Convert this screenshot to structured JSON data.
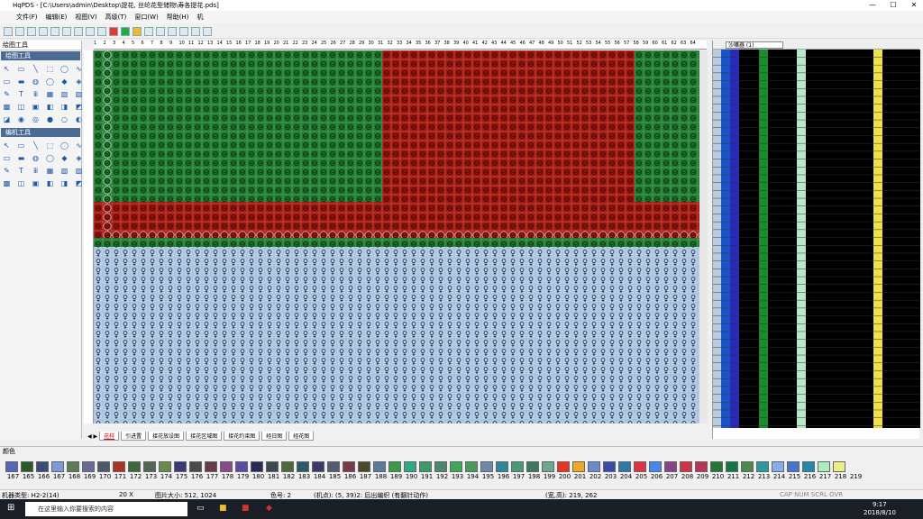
{
  "window": {
    "title": "HqPDS - [C:\\Users\\admin\\Desktop\\提花, 丝纶花型储物\\寿各提花.pds]"
  },
  "menu": [
    "文件(F)",
    "编辑(E)",
    "视图(V)",
    "高级(T)",
    "窗口(W)",
    "帮助(H)",
    "机"
  ],
  "left_panel": {
    "title": "绘图工具",
    "section1": "绘图工具",
    "section2": "编机工具"
  },
  "tabs": [
    "花样",
    "引进置",
    "接花放设图",
    "接花区域图",
    "接花约束图",
    "经日图",
    "经花图"
  ],
  "right_panel": {
    "dropdown": "沙嘴器 (1)"
  },
  "colors": {
    "numbers": [
      "167",
      "165",
      "166",
      "167",
      "168",
      "169",
      "170",
      "171",
      "172",
      "173",
      "174",
      "175",
      "176",
      "177",
      "178",
      "179",
      "180",
      "181",
      "182",
      "183",
      "184",
      "185",
      "186",
      "187",
      "188",
      "189",
      "190",
      "191",
      "192",
      "193",
      "194",
      "195",
      "196",
      "197",
      "198",
      "199",
      "200",
      "201",
      "202",
      "203",
      "204",
      "205",
      "206",
      "207",
      "208",
      "209",
      "210",
      "211",
      "212",
      "213",
      "214",
      "215",
      "216",
      "217",
      "218",
      "219"
    ],
    "swatches": [
      "#5566bb",
      "#2a5a2a",
      "#3a4a7a",
      "#7a9ad8",
      "#5a7a5a",
      "#6a6a9a",
      "#4a5a6a",
      "#aa3322",
      "#3a6a3a",
      "#556655",
      "#6a8a4a",
      "#3a3a7a",
      "#4a4a4a",
      "#6a3a4a",
      "#8a4a8a",
      "#5a4aa4",
      "#2a2a5a",
      "#3a4a4a",
      "#4a6a3a",
      "#2a5a6a",
      "#3a3a6a",
      "#555a77",
      "#7a3a4a",
      "#4a4a2a",
      "#5a7a9a",
      "#3a9a4a",
      "#2aaa88",
      "#3a9a6a",
      "#4a8a6a",
      "#3aaa5a",
      "#4a9a5a",
      "#6a8aaa",
      "#2a8a9a",
      "#4a9a7a",
      "#3a7a5a",
      "#6aaa8a",
      "#e83322",
      "#eeaa22",
      "#6a8acc",
      "#3a4aa8",
      "#2a7aaa",
      "#dd3344",
      "#4488ee",
      "#884488",
      "#cc3344",
      "#bb3355",
      "#227733",
      "#117744",
      "#4a8a4a",
      "#2a9a9a",
      "#88aaee",
      "#4477cc",
      "#2288aa",
      "#aaeebb",
      "#eeee88"
    ]
  },
  "status": {
    "machine": "机器类型: H2-2(14)",
    "zoom": "20 X",
    "image_size": "图片大小: 512, 1024",
    "color": "色号: 2",
    "cell": "(机点): (5, 39)2: 后出编织 (有翻针动作)",
    "pos": "(宽,高): 219, 262",
    "caps": "CAP  NUM  SCRL  OVR"
  },
  "taskbar": {
    "search": "在这里输入你要搜索的内容",
    "time": "9:17",
    "date": "2018/8/10"
  }
}
